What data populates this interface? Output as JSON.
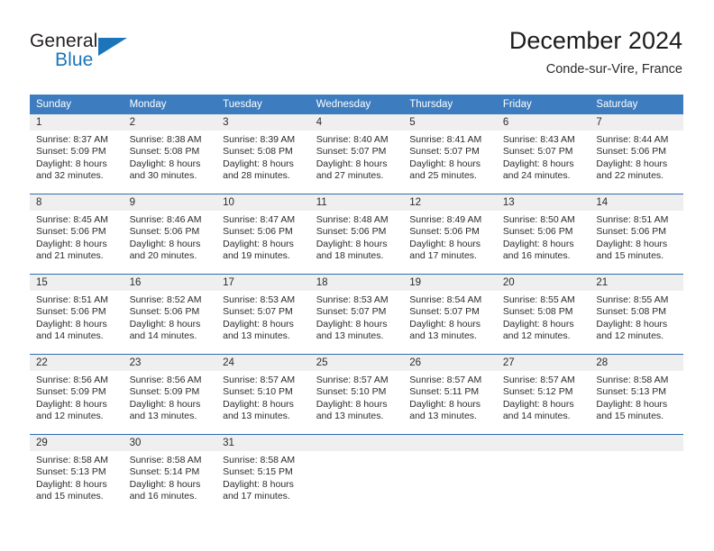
{
  "brand": {
    "name_part1": "General",
    "name_part2": "Blue",
    "logo_icon": "triangle-icon",
    "accent_color": "#1b75bb"
  },
  "header": {
    "title": "December 2024",
    "location": "Conde-sur-Vire, France"
  },
  "calendar": {
    "header_bg": "#3d7dbf",
    "daynum_bg": "#efefef",
    "row_separator_color": "#2f6cae",
    "weekday_headers": [
      "Sunday",
      "Monday",
      "Tuesday",
      "Wednesday",
      "Thursday",
      "Friday",
      "Saturday"
    ],
    "weeks": [
      [
        {
          "day": "1",
          "sunrise": "Sunrise: 8:37 AM",
          "sunset": "Sunset: 5:09 PM",
          "daylight_line1": "Daylight: 8 hours",
          "daylight_line2": "and 32 minutes."
        },
        {
          "day": "2",
          "sunrise": "Sunrise: 8:38 AM",
          "sunset": "Sunset: 5:08 PM",
          "daylight_line1": "Daylight: 8 hours",
          "daylight_line2": "and 30 minutes."
        },
        {
          "day": "3",
          "sunrise": "Sunrise: 8:39 AM",
          "sunset": "Sunset: 5:08 PM",
          "daylight_line1": "Daylight: 8 hours",
          "daylight_line2": "and 28 minutes."
        },
        {
          "day": "4",
          "sunrise": "Sunrise: 8:40 AM",
          "sunset": "Sunset: 5:07 PM",
          "daylight_line1": "Daylight: 8 hours",
          "daylight_line2": "and 27 minutes."
        },
        {
          "day": "5",
          "sunrise": "Sunrise: 8:41 AM",
          "sunset": "Sunset: 5:07 PM",
          "daylight_line1": "Daylight: 8 hours",
          "daylight_line2": "and 25 minutes."
        },
        {
          "day": "6",
          "sunrise": "Sunrise: 8:43 AM",
          "sunset": "Sunset: 5:07 PM",
          "daylight_line1": "Daylight: 8 hours",
          "daylight_line2": "and 24 minutes."
        },
        {
          "day": "7",
          "sunrise": "Sunrise: 8:44 AM",
          "sunset": "Sunset: 5:06 PM",
          "daylight_line1": "Daylight: 8 hours",
          "daylight_line2": "and 22 minutes."
        }
      ],
      [
        {
          "day": "8",
          "sunrise": "Sunrise: 8:45 AM",
          "sunset": "Sunset: 5:06 PM",
          "daylight_line1": "Daylight: 8 hours",
          "daylight_line2": "and 21 minutes."
        },
        {
          "day": "9",
          "sunrise": "Sunrise: 8:46 AM",
          "sunset": "Sunset: 5:06 PM",
          "daylight_line1": "Daylight: 8 hours",
          "daylight_line2": "and 20 minutes."
        },
        {
          "day": "10",
          "sunrise": "Sunrise: 8:47 AM",
          "sunset": "Sunset: 5:06 PM",
          "daylight_line1": "Daylight: 8 hours",
          "daylight_line2": "and 19 minutes."
        },
        {
          "day": "11",
          "sunrise": "Sunrise: 8:48 AM",
          "sunset": "Sunset: 5:06 PM",
          "daylight_line1": "Daylight: 8 hours",
          "daylight_line2": "and 18 minutes."
        },
        {
          "day": "12",
          "sunrise": "Sunrise: 8:49 AM",
          "sunset": "Sunset: 5:06 PM",
          "daylight_line1": "Daylight: 8 hours",
          "daylight_line2": "and 17 minutes."
        },
        {
          "day": "13",
          "sunrise": "Sunrise: 8:50 AM",
          "sunset": "Sunset: 5:06 PM",
          "daylight_line1": "Daylight: 8 hours",
          "daylight_line2": "and 16 minutes."
        },
        {
          "day": "14",
          "sunrise": "Sunrise: 8:51 AM",
          "sunset": "Sunset: 5:06 PM",
          "daylight_line1": "Daylight: 8 hours",
          "daylight_line2": "and 15 minutes."
        }
      ],
      [
        {
          "day": "15",
          "sunrise": "Sunrise: 8:51 AM",
          "sunset": "Sunset: 5:06 PM",
          "daylight_line1": "Daylight: 8 hours",
          "daylight_line2": "and 14 minutes."
        },
        {
          "day": "16",
          "sunrise": "Sunrise: 8:52 AM",
          "sunset": "Sunset: 5:06 PM",
          "daylight_line1": "Daylight: 8 hours",
          "daylight_line2": "and 14 minutes."
        },
        {
          "day": "17",
          "sunrise": "Sunrise: 8:53 AM",
          "sunset": "Sunset: 5:07 PM",
          "daylight_line1": "Daylight: 8 hours",
          "daylight_line2": "and 13 minutes."
        },
        {
          "day": "18",
          "sunrise": "Sunrise: 8:53 AM",
          "sunset": "Sunset: 5:07 PM",
          "daylight_line1": "Daylight: 8 hours",
          "daylight_line2": "and 13 minutes."
        },
        {
          "day": "19",
          "sunrise": "Sunrise: 8:54 AM",
          "sunset": "Sunset: 5:07 PM",
          "daylight_line1": "Daylight: 8 hours",
          "daylight_line2": "and 13 minutes."
        },
        {
          "day": "20",
          "sunrise": "Sunrise: 8:55 AM",
          "sunset": "Sunset: 5:08 PM",
          "daylight_line1": "Daylight: 8 hours",
          "daylight_line2": "and 12 minutes."
        },
        {
          "day": "21",
          "sunrise": "Sunrise: 8:55 AM",
          "sunset": "Sunset: 5:08 PM",
          "daylight_line1": "Daylight: 8 hours",
          "daylight_line2": "and 12 minutes."
        }
      ],
      [
        {
          "day": "22",
          "sunrise": "Sunrise: 8:56 AM",
          "sunset": "Sunset: 5:09 PM",
          "daylight_line1": "Daylight: 8 hours",
          "daylight_line2": "and 12 minutes."
        },
        {
          "day": "23",
          "sunrise": "Sunrise: 8:56 AM",
          "sunset": "Sunset: 5:09 PM",
          "daylight_line1": "Daylight: 8 hours",
          "daylight_line2": "and 13 minutes."
        },
        {
          "day": "24",
          "sunrise": "Sunrise: 8:57 AM",
          "sunset": "Sunset: 5:10 PM",
          "daylight_line1": "Daylight: 8 hours",
          "daylight_line2": "and 13 minutes."
        },
        {
          "day": "25",
          "sunrise": "Sunrise: 8:57 AM",
          "sunset": "Sunset: 5:10 PM",
          "daylight_line1": "Daylight: 8 hours",
          "daylight_line2": "and 13 minutes."
        },
        {
          "day": "26",
          "sunrise": "Sunrise: 8:57 AM",
          "sunset": "Sunset: 5:11 PM",
          "daylight_line1": "Daylight: 8 hours",
          "daylight_line2": "and 13 minutes."
        },
        {
          "day": "27",
          "sunrise": "Sunrise: 8:57 AM",
          "sunset": "Sunset: 5:12 PM",
          "daylight_line1": "Daylight: 8 hours",
          "daylight_line2": "and 14 minutes."
        },
        {
          "day": "28",
          "sunrise": "Sunrise: 8:58 AM",
          "sunset": "Sunset: 5:13 PM",
          "daylight_line1": "Daylight: 8 hours",
          "daylight_line2": "and 15 minutes."
        }
      ],
      [
        {
          "day": "29",
          "sunrise": "Sunrise: 8:58 AM",
          "sunset": "Sunset: 5:13 PM",
          "daylight_line1": "Daylight: 8 hours",
          "daylight_line2": "and 15 minutes."
        },
        {
          "day": "30",
          "sunrise": "Sunrise: 8:58 AM",
          "sunset": "Sunset: 5:14 PM",
          "daylight_line1": "Daylight: 8 hours",
          "daylight_line2": "and 16 minutes."
        },
        {
          "day": "31",
          "sunrise": "Sunrise: 8:58 AM",
          "sunset": "Sunset: 5:15 PM",
          "daylight_line1": "Daylight: 8 hours",
          "daylight_line2": "and 17 minutes."
        },
        {
          "day": "",
          "sunrise": "",
          "sunset": "",
          "daylight_line1": "",
          "daylight_line2": ""
        },
        {
          "day": "",
          "sunrise": "",
          "sunset": "",
          "daylight_line1": "",
          "daylight_line2": ""
        },
        {
          "day": "",
          "sunrise": "",
          "sunset": "",
          "daylight_line1": "",
          "daylight_line2": ""
        },
        {
          "day": "",
          "sunrise": "",
          "sunset": "",
          "daylight_line1": "",
          "daylight_line2": ""
        }
      ]
    ]
  }
}
